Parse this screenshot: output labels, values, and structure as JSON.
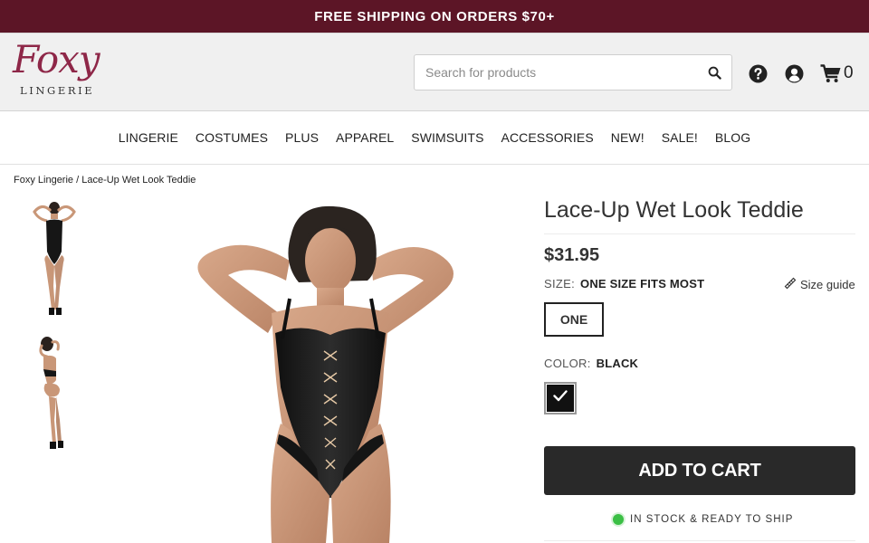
{
  "promo": {
    "text": "FREE SHIPPING ON ORDERS $70+"
  },
  "header": {
    "logo": {
      "script": "Foxy",
      "sub": "LINGERIE"
    },
    "search": {
      "placeholder": "Search for products",
      "value": ""
    },
    "icons": [
      "search-icon",
      "help-icon",
      "account-icon",
      "cart-icon"
    ],
    "cart_count": "0"
  },
  "nav": [
    "LINGERIE",
    "COSTUMES",
    "PLUS",
    "APPAREL",
    "SWIMSUITS",
    "ACCESSORIES",
    "NEW!",
    "SALE!",
    "BLOG"
  ],
  "breadcrumb": {
    "home": "Foxy Lingerie",
    "sep": " / ",
    "current": "Lace-Up Wet Look Teddie"
  },
  "product": {
    "title": "Lace-Up Wet Look Teddie",
    "price": "$31.95",
    "size_label": "SIZE:",
    "size_value": "ONE SIZE FITS MOST",
    "size_guide": "Size guide",
    "size_option": "ONE",
    "color_label": "COLOR:",
    "color_value": "BLACK",
    "color_swatch": "#111111",
    "add_to_cart": "ADD TO CART",
    "stock": "IN STOCK & READY TO SHIP"
  },
  "colors": {
    "brand": "#5c1526",
    "logo": "#8e2748",
    "button": "#292929",
    "stock_dot": "#3bbf45"
  }
}
